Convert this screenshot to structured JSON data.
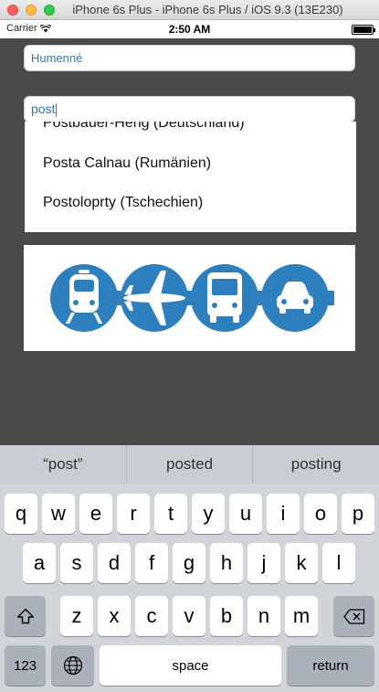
{
  "window": {
    "title": "iPhone 6s Plus - iPhone 6s Plus / iOS 9.3 (13E230)"
  },
  "status_bar": {
    "carrier": "Carrier",
    "time": "2:50 AM"
  },
  "from_field": {
    "value": "Humenné"
  },
  "search_field": {
    "value": "post"
  },
  "suggestions": [
    "Postbauer-Heng (Deutschland)",
    "Posta Calnau (Rumänien)",
    "Postoloprty (Tschechien)"
  ],
  "banner": {
    "icons": [
      "train-icon",
      "airplane-icon",
      "bus-icon",
      "car-icon"
    ],
    "color": "#2e7fbd"
  },
  "keyboard": {
    "predictions": [
      "“post”",
      "posted",
      "posting"
    ],
    "row1": [
      "q",
      "w",
      "e",
      "r",
      "t",
      "y",
      "u",
      "i",
      "o",
      "p"
    ],
    "row2": [
      "a",
      "s",
      "d",
      "f",
      "g",
      "h",
      "j",
      "k",
      "l"
    ],
    "row3": [
      "z",
      "x",
      "c",
      "v",
      "b",
      "n",
      "m"
    ],
    "numbers_label": "123",
    "space_label": "space",
    "return_label": "return"
  }
}
